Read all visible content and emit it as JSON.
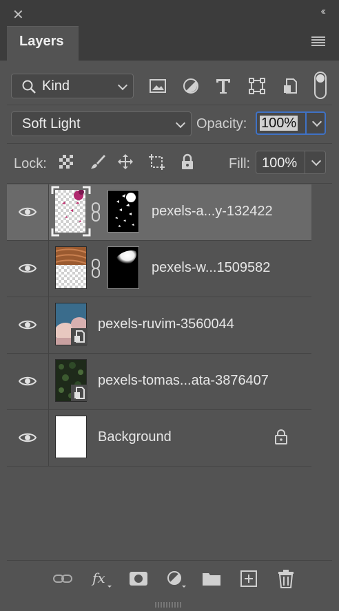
{
  "panel": {
    "tab_label": "Layers"
  },
  "filter": {
    "kind_label": "Kind"
  },
  "blend": {
    "mode": "Soft Light",
    "opacity_label": "Opacity:",
    "opacity_value": "100%"
  },
  "lock": {
    "label": "Lock:",
    "fill_label": "Fill:",
    "fill_value": "100%"
  },
  "layers": [
    {
      "name": "pexels-a...y-132422",
      "selected": true
    },
    {
      "name": "pexels-w...1509582",
      "selected": false
    },
    {
      "name": "pexels-ruvim-3560044",
      "selected": false
    },
    {
      "name": "pexels-tomas...ata-3876407",
      "selected": false
    },
    {
      "name": "Background",
      "selected": false
    }
  ],
  "colors": {
    "panel_bg": "#535353",
    "selected_row": "#6a6a6a",
    "accent_blue": "#3f72c6"
  }
}
